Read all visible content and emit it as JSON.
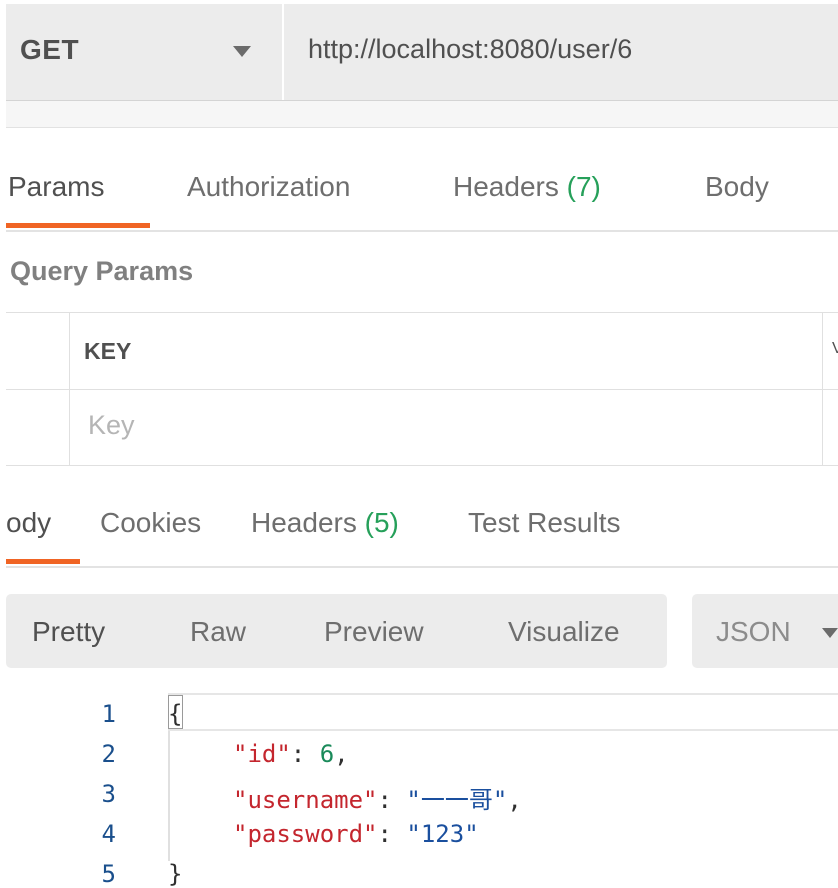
{
  "request": {
    "method": "GET",
    "url": "http://localhost:8080/user/6"
  },
  "request_tabs": {
    "params": "Params",
    "authorization": "Authorization",
    "headers_label": "Headers",
    "headers_count": "(7)",
    "body": "Body"
  },
  "query_params": {
    "title": "Query Params",
    "key_header": "KEY",
    "key_placeholder": "Key",
    "value_header_fragment": "V"
  },
  "response_tabs": {
    "body_fragment": "ody",
    "cookies": "Cookies",
    "headers_label": "Headers",
    "headers_count": "(5)",
    "test_results": "Test Results"
  },
  "format_toolbar": {
    "pretty": "Pretty",
    "raw": "Raw",
    "preview": "Preview",
    "visualize": "Visualize",
    "language": "JSON"
  },
  "response_body": {
    "line_numbers": [
      "1",
      "2",
      "3",
      "4",
      "5"
    ],
    "open_brace": "{",
    "close_brace": "}",
    "fields": [
      {
        "key": "\"id\"",
        "value": "6",
        "trailing": ","
      },
      {
        "key": "\"username\"",
        "value": "\"一一哥\"",
        "trailing": ","
      },
      {
        "key": "\"password\"",
        "value": "\"123\"",
        "trailing": ""
      }
    ],
    "colon": ": "
  },
  "colors": {
    "accent": "#f06424",
    "count_green": "#26a05a",
    "json_key": "#c4262e",
    "json_number": "#1a8a5a",
    "json_string": "#1a4f9e"
  }
}
